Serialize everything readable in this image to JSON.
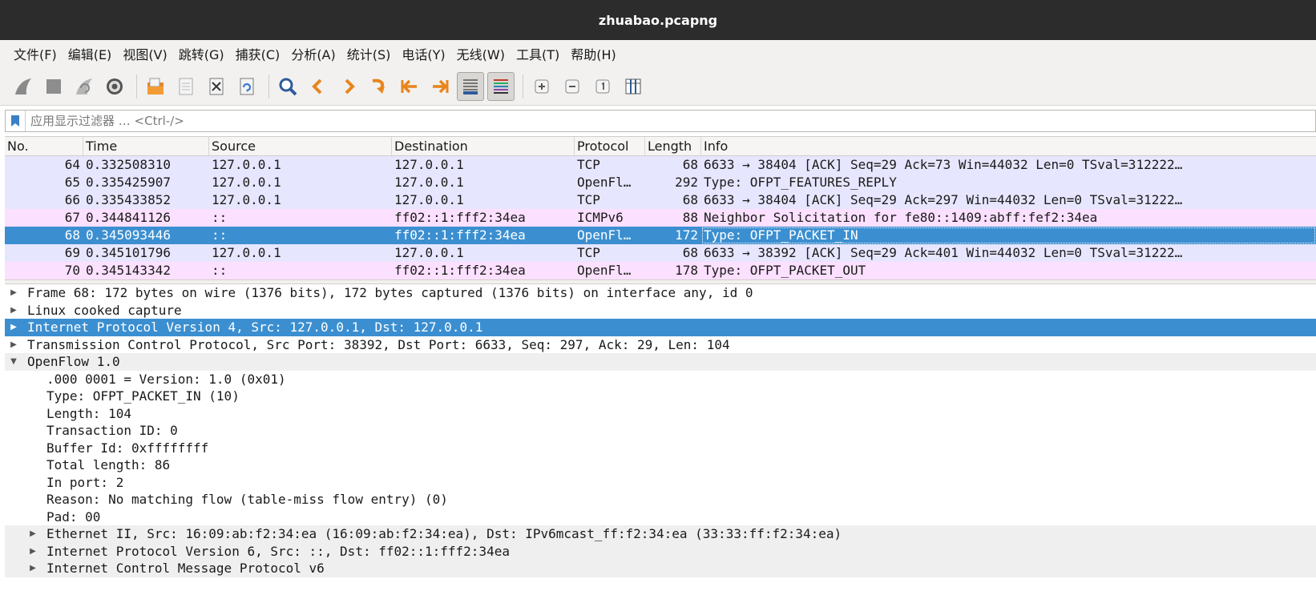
{
  "window": {
    "title": "zhuabao.pcapng"
  },
  "menu": [
    "文件(F)",
    "编辑(E)",
    "视图(V)",
    "跳转(G)",
    "捕获(C)",
    "分析(A)",
    "统计(S)",
    "电话(Y)",
    "无线(W)",
    "工具(T)",
    "帮助(H)"
  ],
  "toolbar": {
    "icons": [
      "shark-fin-start-icon",
      "stop-capture-icon",
      "restart-capture-icon",
      "capture-options-icon",
      "open-file-icon",
      "save-file-icon",
      "close-file-icon",
      "reload-file-icon",
      "find-packet-icon",
      "go-back-icon",
      "go-forward-icon",
      "go-to-packet-icon",
      "go-first-icon",
      "go-last-icon",
      "autoscroll-icon",
      "colorize-icon",
      "zoom-in-icon",
      "zoom-out-icon",
      "normal-size-icon",
      "resize-columns-icon"
    ]
  },
  "filter": {
    "placeholder": "应用显示过滤器 … <Ctrl-/>"
  },
  "columns": {
    "no": "No.",
    "time": "Time",
    "source": "Source",
    "destination": "Destination",
    "protocol": "Protocol",
    "length": "Length",
    "info": "Info"
  },
  "packets": [
    {
      "no": "64",
      "time": "0.332508310",
      "source": "127.0.0.1",
      "destination": "127.0.0.1",
      "protocol": "TCP",
      "length": "68",
      "info": "6633 → 38404 [ACK] Seq=29 Ack=73 Win=44032 Len=0 TSval=312222…"
    },
    {
      "no": "65",
      "time": "0.335425907",
      "source": "127.0.0.1",
      "destination": "127.0.0.1",
      "protocol": "OpenFl…",
      "length": "292",
      "info": "Type: OFPT_FEATURES_REPLY"
    },
    {
      "no": "66",
      "time": "0.335433852",
      "source": "127.0.0.1",
      "destination": "127.0.0.1",
      "protocol": "TCP",
      "length": "68",
      "info": "6633 → 38404 [ACK] Seq=29 Ack=297 Win=44032 Len=0 TSval=31222…"
    },
    {
      "no": "67",
      "time": "0.344841126",
      "source": "::",
      "destination": "ff02::1:fff2:34ea",
      "protocol": "ICMPv6",
      "length": "88",
      "info": "Neighbor Solicitation for fe80::1409:abff:fef2:34ea"
    },
    {
      "no": "68",
      "time": "0.345093446",
      "source": "::",
      "destination": "ff02::1:fff2:34ea",
      "protocol": "OpenFl…",
      "length": "172",
      "info": "Type: OFPT_PACKET_IN"
    },
    {
      "no": "69",
      "time": "0.345101796",
      "source": "127.0.0.1",
      "destination": "127.0.0.1",
      "protocol": "TCP",
      "length": "68",
      "info": "6633 → 38392 [ACK] Seq=29 Ack=401 Win=44032 Len=0 TSval=31222…"
    },
    {
      "no": "70",
      "time": "0.345143342",
      "source": "::",
      "destination": "ff02::1:fff2:34ea",
      "protocol": "OpenFl…",
      "length": "178",
      "info": "Type: OFPT_PACKET_OUT"
    }
  ],
  "details": [
    "Frame 68: 172 bytes on wire (1376 bits), 172 bytes captured (1376 bits) on interface any, id 0",
    "Linux cooked capture",
    "Internet Protocol Version 4, Src: 127.0.0.1, Dst: 127.0.0.1",
    "Transmission Control Protocol, Src Port: 38392, Dst Port: 6633, Seq: 297, Ack: 29, Len: 104",
    "OpenFlow 1.0",
    ".000 0001 = Version: 1.0 (0x01)",
    "Type: OFPT_PACKET_IN (10)",
    "Length: 104",
    "Transaction ID: 0",
    "Buffer Id: 0xffffffff",
    "Total length: 86",
    "In port: 2",
    "Reason: No matching flow (table-miss flow entry) (0)",
    "Pad: 00",
    "Ethernet II, Src: 16:09:ab:f2:34:ea (16:09:ab:f2:34:ea), Dst: IPv6mcast_ff:f2:34:ea (33:33:ff:f2:34:ea)",
    "Internet Protocol Version 6, Src: ::, Dst: ff02::1:fff2:34ea",
    "Internet Control Message Protocol v6"
  ],
  "colors": {
    "selected": "#3b8fd0",
    "tcp_row": "#e7e6ff",
    "icmp_row": "#fce0ff",
    "titlebar": "#2c2c2c"
  }
}
